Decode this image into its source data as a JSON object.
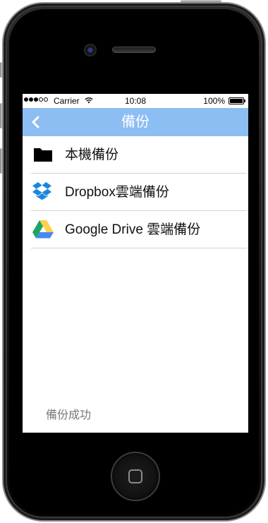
{
  "status_bar": {
    "carrier": "Carrier",
    "time": "10:08",
    "battery": "100%"
  },
  "nav": {
    "title": "備份",
    "back_icon": "chevron-left-icon"
  },
  "backup_options": [
    {
      "label": "本機備份",
      "icon": "folder-icon"
    },
    {
      "label": "Dropbox雲端備份",
      "icon": "dropbox-icon"
    },
    {
      "label": "Google Drive 雲端備份",
      "icon": "google-drive-icon"
    }
  ],
  "footer": {
    "status_text": "備份成功"
  },
  "colors": {
    "nav_background": "#8cbdf3",
    "dropbox_blue": "#1a86e0",
    "drive_green": "#1fa463",
    "drive_yellow": "#ffd04b",
    "drive_blue": "#4688f1"
  }
}
